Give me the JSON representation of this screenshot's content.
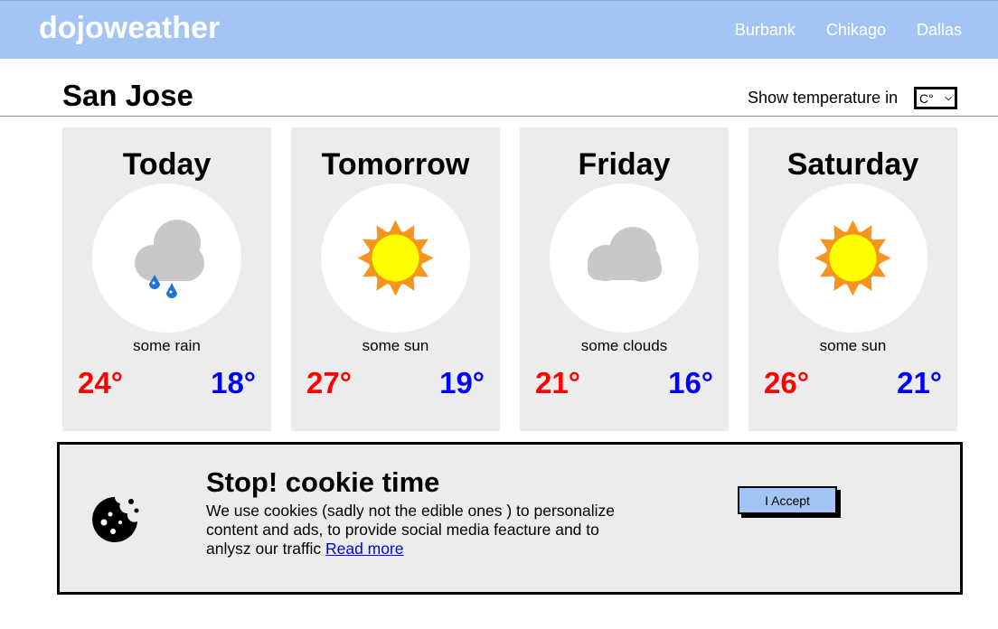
{
  "app": {
    "name": "dojoweather"
  },
  "nav": {
    "items": [
      "Burbank",
      "Chikago",
      "Dallas"
    ]
  },
  "city": "San Jose",
  "unit": {
    "label": "Show temperature in",
    "selected": "C°"
  },
  "forecast": [
    {
      "day": "Today",
      "icon": "rain-cloud-icon",
      "desc": "some rain",
      "high": "24°",
      "low": "18°"
    },
    {
      "day": "Tomorrow",
      "icon": "sun-icon",
      "desc": "some sun",
      "high": "27°",
      "low": "19°"
    },
    {
      "day": "Friday",
      "icon": "cloud-icon",
      "desc": "some clouds",
      "high": "21°",
      "low": "16°"
    },
    {
      "day": "Saturday",
      "icon": "sun-icon",
      "desc": "some sun",
      "high": "26°",
      "low": "21°"
    }
  ],
  "cookie": {
    "title": "Stop! cookie time",
    "text": "We use cookies (sadly not the edible ones ) to personalize content and ads, to provide social media feacture and to anlysz our traffic",
    "link": "Read more",
    "accept": "I Accept"
  },
  "colors": {
    "header": "#a2c5f5",
    "high": "#ff0000",
    "low": "#0000ff",
    "card": "#ececec"
  }
}
